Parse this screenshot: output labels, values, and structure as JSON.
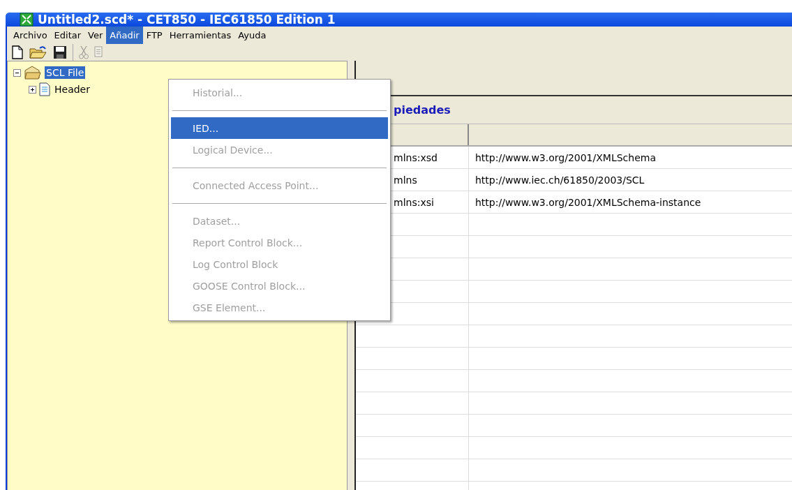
{
  "window": {
    "title": "Untitled2.scd* - CET850 - IEC61850 Edition 1"
  },
  "menubar": [
    {
      "label": "Archivo",
      "selected": false
    },
    {
      "label": "Editar",
      "selected": false
    },
    {
      "label": "Ver",
      "selected": false
    },
    {
      "label": "Añadir",
      "selected": true
    },
    {
      "label": "FTP",
      "selected": false
    },
    {
      "label": "Herramientas",
      "selected": false
    },
    {
      "label": "Ayuda",
      "selected": false
    }
  ],
  "toolbar": [
    {
      "kind": "new",
      "disabled": false
    },
    {
      "kind": "open",
      "disabled": false
    },
    {
      "kind": "save",
      "disabled": false
    },
    {
      "kind": "separator"
    },
    {
      "kind": "cut",
      "disabled": true
    },
    {
      "kind": "copy",
      "disabled": true
    }
  ],
  "tree": [
    {
      "label": "SCL File",
      "selected": true,
      "expanded": true,
      "kind": "folder",
      "children": [
        {
          "label": "Header",
          "selected": false,
          "expanded": false,
          "kind": "document"
        }
      ]
    }
  ],
  "properties": {
    "title": "piedades",
    "rows": [
      {
        "name": "mlns:xsd",
        "value": "http://www.w3.org/2001/XMLSchema"
      },
      {
        "name": "mlns",
        "value": "http://www.iec.ch/61850/2003/SCL"
      },
      {
        "name": "mlns:xsi",
        "value": "http://www.w3.org/2001/XMLSchema-instance"
      }
    ]
  },
  "menu": [
    {
      "kind": "item",
      "label": "Historial...",
      "disabled": true,
      "selected": false
    },
    {
      "kind": "separator"
    },
    {
      "kind": "item",
      "label": "IED...",
      "disabled": false,
      "selected": true
    },
    {
      "kind": "item",
      "label": "Logical Device...",
      "disabled": true,
      "selected": false
    },
    {
      "kind": "separator"
    },
    {
      "kind": "item",
      "label": "Connected Access Point...",
      "disabled": true,
      "selected": false
    },
    {
      "kind": "separator"
    },
    {
      "kind": "item",
      "label": "Dataset...",
      "disabled": true,
      "selected": false
    },
    {
      "kind": "item",
      "label": "Report Control Block...",
      "disabled": true,
      "selected": false
    },
    {
      "kind": "item",
      "label": "Log Control Block",
      "disabled": true,
      "selected": false
    },
    {
      "kind": "item",
      "label": "GOOSE Control Block...",
      "disabled": true,
      "selected": false
    },
    {
      "kind": "item",
      "label": "GSE Element...",
      "disabled": true,
      "selected": false
    }
  ]
}
